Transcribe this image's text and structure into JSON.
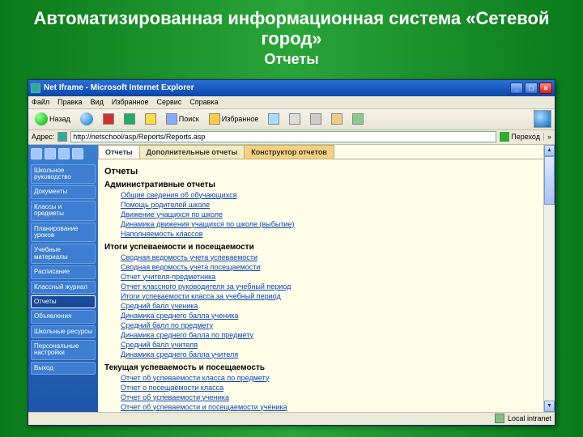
{
  "slide": {
    "title": "Автоматизированная информационная система «Сетевой город»",
    "subtitle": "Отчеты"
  },
  "window": {
    "title": "Net Iframe - Microsoft Internet Explorer"
  },
  "menubar": [
    "Файл",
    "Правка",
    "Вид",
    "Избранное",
    "Сервис",
    "Справка"
  ],
  "toolbar": {
    "back": "Назад",
    "forward": "",
    "search": "Поиск",
    "fav": "Избранное"
  },
  "addr": {
    "label": "Адрес:",
    "url": "http://netschool/asp/Reports/Reports.asp",
    "go": "Переход"
  },
  "tabs": {
    "t1": "Отчеты",
    "t2": "Дополнительные отчеты",
    "t3": "Конструктор отчетов"
  },
  "sidebar": [
    "Школьное руководство",
    "Документы",
    "Классы и предметы",
    "Планирование уроков",
    "Учебные материалы",
    "Расписание",
    "Классный журнал",
    "Отчеты",
    "Объявления",
    "Школьные ресурсы",
    "Персональные настройки",
    "Выход"
  ],
  "reports": {
    "h": "Отчеты",
    "s1": "Административные отчеты",
    "s1links": [
      "Общие сведения об обучающихся",
      "Помощь родителей школе",
      "Движение учащихся по школе",
      "Динамика движения учащихся по школе (выбытие)",
      "Наполняемость классов"
    ],
    "s2": "Итоги успеваемости и посещаемости",
    "s2links": [
      "Сводная ведомость учета успеваемости",
      "Сводная ведомость учета посещаемости",
      "Отчет учителя-предметника",
      "Отчет классного руководителя за учебный период",
      "Итоги успеваемости класса за учебный период",
      "Средний балл ученика",
      "Динамика среднего балла ученика",
      "Средний балл по предмету",
      "Динамика среднего балла по предмету",
      "Средний балл учителя",
      "Динамика среднего балла учителя"
    ],
    "s3": "Текущая успеваемость и посещаемость",
    "s3links": [
      "Отчет об успеваемости класса по предмету",
      "Отчет о посещаемости класса",
      "Отчет об успеваемости ученика",
      "Отчет об успеваемости и посещаемости ученика"
    ]
  },
  "status": {
    "zone": "Local intranet"
  }
}
